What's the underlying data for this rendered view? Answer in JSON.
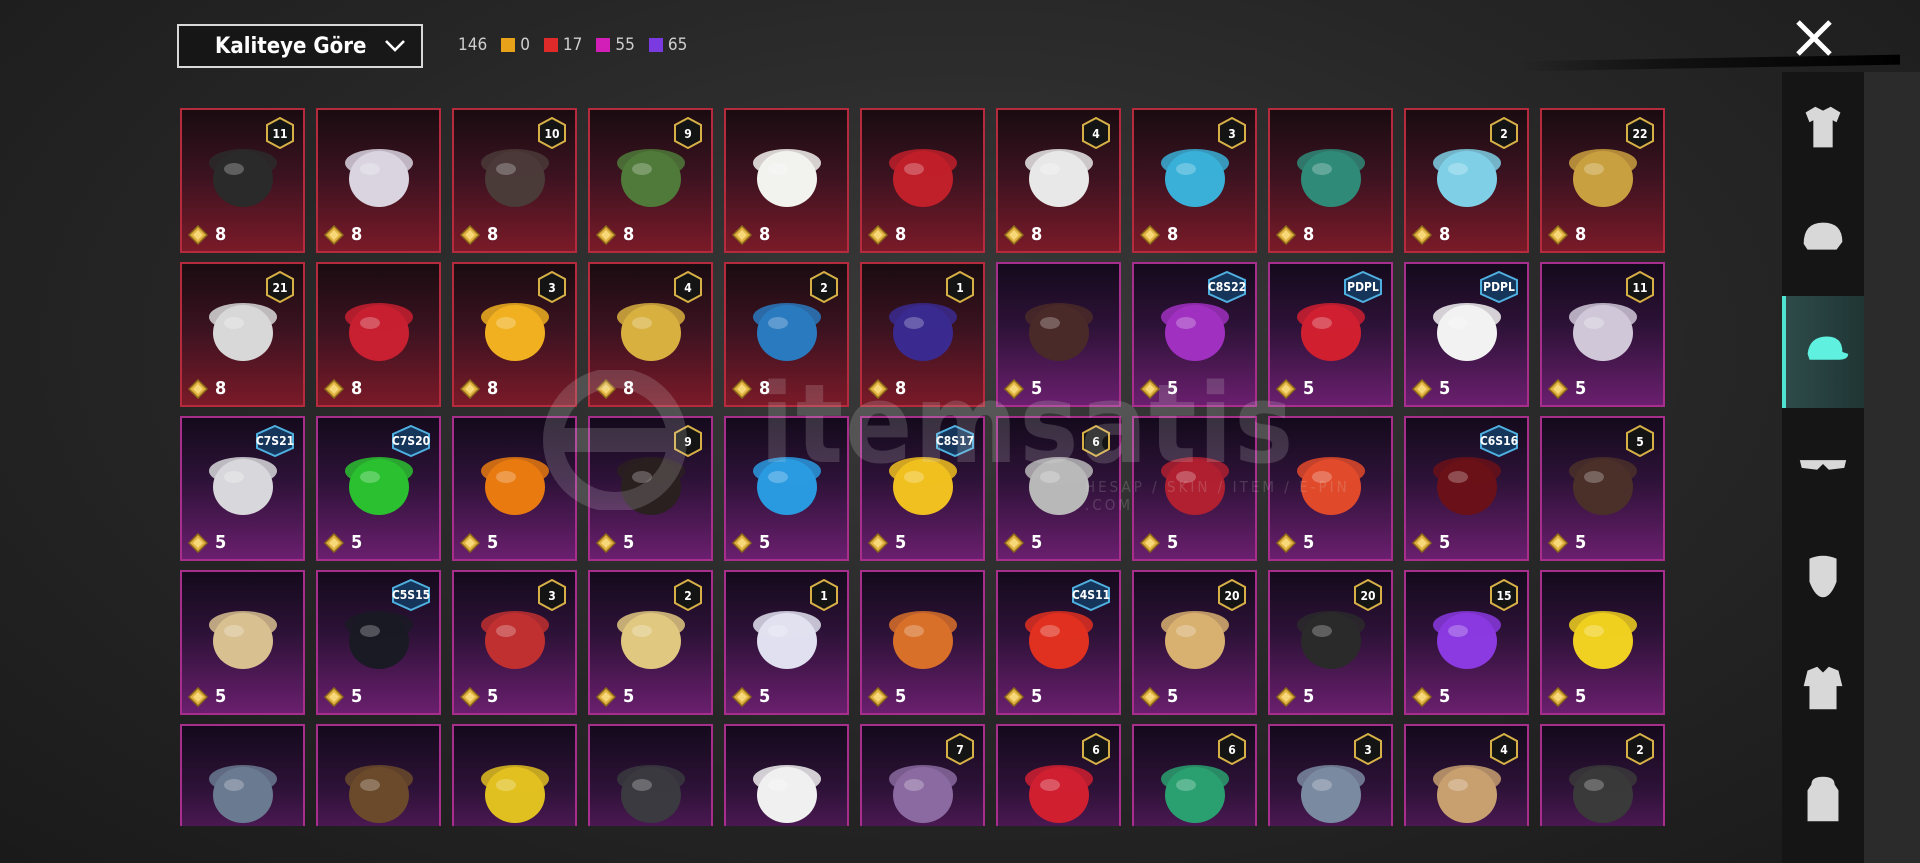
{
  "sort": {
    "label": "Kaliteye Göre"
  },
  "counts": {
    "total": "146",
    "legendary": {
      "value": "0",
      "color": "#e8a21a"
    },
    "mythic": {
      "value": "17",
      "color": "#e02a2a"
    },
    "epic": {
      "value": "55",
      "color": "#d21fb8"
    },
    "rare": {
      "value": "65",
      "color": "#7a3ae0"
    }
  },
  "watermark": {
    "text": "itemsatis",
    "sub": "HESAP / SKIN / ITEM / E-PIN .COM"
  },
  "items": [
    {
      "tier": "red",
      "price": "8",
      "badge": "11",
      "icon": "black-helmet-icon",
      "color": "#2a2a2a"
    },
    {
      "tier": "red",
      "price": "8",
      "badge": "",
      "icon": "white-ghost-hair-icon",
      "color": "#d9d4e0"
    },
    {
      "tier": "red",
      "price": "8",
      "badge": "10",
      "icon": "dark-hair-icon",
      "color": "#4a3a38"
    },
    {
      "tier": "red",
      "price": "8",
      "badge": "9",
      "icon": "zombie-mask-icon",
      "color": "#4f7a3a"
    },
    {
      "tier": "red",
      "price": "8",
      "badge": "",
      "icon": "white-cowboy-hat-icon",
      "color": "#f2f2ee"
    },
    {
      "tier": "red",
      "price": "8",
      "badge": "",
      "icon": "red-helmet-icon",
      "color": "#c0202a"
    },
    {
      "tier": "red",
      "price": "8",
      "badge": "4",
      "icon": "snowman-hat-icon",
      "color": "#e8e8e8"
    },
    {
      "tier": "red",
      "price": "8",
      "badge": "3",
      "icon": "joker-mask-icon",
      "color": "#3ab0d8"
    },
    {
      "tier": "red",
      "price": "8",
      "badge": "",
      "icon": "dragon-helmet-icon",
      "color": "#2f8a78"
    },
    {
      "tier": "red",
      "price": "8",
      "badge": "2",
      "icon": "blue-bucket-hat-icon",
      "color": "#7fd0e6"
    },
    {
      "tier": "red",
      "price": "8",
      "badge": "22",
      "icon": "gold-helmet-icon",
      "color": "#c9a040"
    },
    {
      "tier": "red",
      "price": "8",
      "badge": "21",
      "icon": "clown-mask-icon",
      "color": "#d8d8d8"
    },
    {
      "tier": "red",
      "price": "8",
      "badge": "",
      "icon": "oni-mask-icon",
      "color": "#c82030"
    },
    {
      "tier": "red",
      "price": "8",
      "badge": "3",
      "icon": "fries-hat-icon",
      "color": "#f0b020"
    },
    {
      "tier": "red",
      "price": "8",
      "badge": "4",
      "icon": "gold-purple-helmet-icon",
      "color": "#d8b040"
    },
    {
      "tier": "red",
      "price": "8",
      "badge": "2",
      "icon": "blue-samurai-helmet-icon",
      "color": "#2a7ac0"
    },
    {
      "tier": "red",
      "price": "8",
      "badge": "1",
      "icon": "purple-helmet-icon",
      "color": "#3a2a90"
    },
    {
      "tier": "purple",
      "price": "5",
      "badge": "",
      "icon": "brown-hair-icon",
      "color": "#4a2a28"
    },
    {
      "tier": "purple",
      "price": "5",
      "badge": "C8S22",
      "icon": "purple-hair-icon",
      "color": "#a030c0"
    },
    {
      "tier": "purple",
      "price": "5",
      "badge": "PDPL",
      "icon": "red-hair-icon",
      "color": "#d02030"
    },
    {
      "tier": "purple",
      "price": "5",
      "badge": "PDPL",
      "icon": "panda-mask-icon",
      "color": "#f2f2f2"
    },
    {
      "tier": "purple",
      "price": "5",
      "badge": "11",
      "icon": "flower-crown-hair-icon",
      "color": "#d0c8d8"
    },
    {
      "tier": "purple",
      "price": "5",
      "badge": "C7S21",
      "icon": "silver-hair-icon",
      "color": "#d8d8dc"
    },
    {
      "tier": "purple",
      "price": "5",
      "badge": "C7S20",
      "icon": "green-hair-icon",
      "color": "#2ac030"
    },
    {
      "tier": "purple",
      "price": "5",
      "badge": "",
      "icon": "pumpkin-head-icon",
      "color": "#e87a10"
    },
    {
      "tier": "purple",
      "price": "5",
      "badge": "9",
      "icon": "black-long-hair-icon",
      "color": "#2a2020"
    },
    {
      "tier": "purple",
      "price": "5",
      "badge": "",
      "icon": "blue-cat-cap-icon",
      "color": "#2a9ae0"
    },
    {
      "tier": "purple",
      "price": "5",
      "badge": "C8S17",
      "icon": "yellow-visor-icon",
      "color": "#f0c020"
    },
    {
      "tier": "purple",
      "price": "5",
      "badge": "6",
      "icon": "knight-helmet-icon",
      "color": "#b8b8b8"
    },
    {
      "tier": "purple",
      "price": "5",
      "badge": "",
      "icon": "red-scarf-mask-icon",
      "color": "#b02030"
    },
    {
      "tier": "purple",
      "price": "5",
      "badge": "",
      "icon": "lion-dance-mask-icon",
      "color": "#e04a2a"
    },
    {
      "tier": "purple",
      "price": "5",
      "badge": "C6S16",
      "icon": "red-hood-icon",
      "color": "#6a1018"
    },
    {
      "tier": "purple",
      "price": "5",
      "badge": "5",
      "icon": "pigtail-hair-icon",
      "color": "#4a3028"
    },
    {
      "tier": "purple",
      "price": "5",
      "badge": "",
      "icon": "blonde-curly-hair-icon",
      "color": "#d8c090"
    },
    {
      "tier": "purple",
      "price": "5",
      "badge": "C5S15",
      "icon": "black-cap-icon",
      "color": "#1a1a24"
    },
    {
      "tier": "purple",
      "price": "5",
      "badge": "3",
      "icon": "jester-hat-icon",
      "color": "#c03030"
    },
    {
      "tier": "purple",
      "price": "5",
      "badge": "2",
      "icon": "blonde-hair-hat-icon",
      "color": "#e0c880"
    },
    {
      "tier": "purple",
      "price": "5",
      "badge": "1",
      "icon": "white-twin-hair-icon",
      "color": "#e0e0f0"
    },
    {
      "tier": "purple",
      "price": "5",
      "badge": "",
      "icon": "horned-skull-icon",
      "color": "#d8702a"
    },
    {
      "tier": "purple",
      "price": "5",
      "badge": "C4S11",
      "icon": "red-cap-icon",
      "color": "#e03020"
    },
    {
      "tier": "purple",
      "price": "5",
      "badge": "20",
      "icon": "witch-hat-hair-icon",
      "color": "#d8b070"
    },
    {
      "tier": "purple",
      "price": "5",
      "badge": "20",
      "icon": "gold-black-mask-icon",
      "color": "#2a2a2a"
    },
    {
      "tier": "purple",
      "price": "5",
      "badge": "15",
      "icon": "bird-mask-icon",
      "color": "#8a3ae0"
    },
    {
      "tier": "purple",
      "price": "5",
      "badge": "",
      "icon": "chick-mask-icon",
      "color": "#f0d020"
    },
    {
      "tier": "purple",
      "price": "",
      "badge": "",
      "icon": "shark-mask-icon",
      "color": "#6a7a90"
    },
    {
      "tier": "purple",
      "price": "",
      "badge": "",
      "icon": "cowboy-hat-icon",
      "color": "#6a4a2a"
    },
    {
      "tier": "purple",
      "price": "",
      "badge": "",
      "icon": "yellow-monster-hat-icon",
      "color": "#e0c020"
    },
    {
      "tier": "purple",
      "price": "",
      "badge": "",
      "icon": "black-mask-icon",
      "color": "#3a3a40"
    },
    {
      "tier": "purple",
      "price": "",
      "badge": "",
      "icon": "rooster-mask-icon",
      "color": "#f0f0f0"
    },
    {
      "tier": "purple",
      "price": "",
      "badge": "7",
      "icon": "royal-hat-icon",
      "color": "#8a6aa0"
    },
    {
      "tier": "purple",
      "price": "",
      "badge": "6",
      "icon": "santa-hat-icon",
      "color": "#d02030"
    },
    {
      "tier": "purple",
      "price": "",
      "badge": "6",
      "icon": "christmas-tree-hat-icon",
      "color": "#2aa070"
    },
    {
      "tier": "purple",
      "price": "",
      "badge": "3",
      "icon": "ufo-hat-icon",
      "color": "#7a8aa0"
    },
    {
      "tier": "purple",
      "price": "",
      "badge": "4",
      "icon": "oni-gold-mask-icon",
      "color": "#c8a070"
    },
    {
      "tier": "purple",
      "price": "",
      "badge": "2",
      "icon": "predator-mask-icon",
      "color": "#3a3a3a"
    }
  ],
  "sidebar": [
    {
      "name": "outfit-tab",
      "icon": "outfit-icon"
    },
    {
      "name": "helmet-tab",
      "icon": "helmet-icon"
    },
    {
      "name": "hat-tab",
      "icon": "cap-icon",
      "active": true
    },
    {
      "name": "eyewear-tab",
      "icon": "glasses-icon"
    },
    {
      "name": "mask-tab",
      "icon": "mask-icon"
    },
    {
      "name": "top-tab",
      "icon": "shirt-icon"
    },
    {
      "name": "backpack-tab",
      "icon": "backpack-icon"
    }
  ]
}
